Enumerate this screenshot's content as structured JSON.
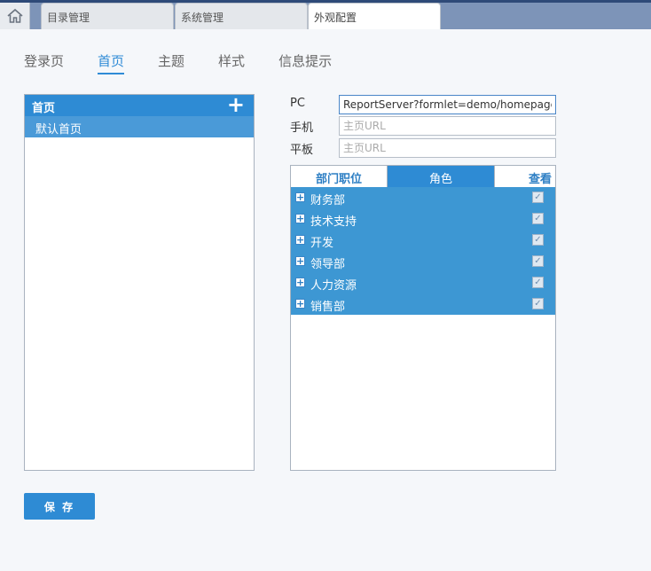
{
  "tabs": {
    "home_icon": "home-icon",
    "items": [
      {
        "label": "目录管理"
      },
      {
        "label": "系统管理"
      },
      {
        "label": "外观配置"
      }
    ]
  },
  "subnav": {
    "items": [
      {
        "label": "登录页"
      },
      {
        "label": "首页",
        "active": true
      },
      {
        "label": "主题"
      },
      {
        "label": "样式"
      },
      {
        "label": "信息提示"
      }
    ]
  },
  "homepage_list": {
    "header": "首页",
    "add_icon": "plus-icon",
    "items": [
      {
        "label": "默认首页"
      }
    ]
  },
  "form": {
    "pc": {
      "label": "PC",
      "value": "ReportServer?formlet=demo/homepage/finereport_homepage.frm"
    },
    "phone": {
      "label": "手机",
      "placeholder": "主页URL"
    },
    "tablet": {
      "label": "平板",
      "placeholder": "主页URL"
    }
  },
  "permissions": {
    "tabs": {
      "dept": "部门职位",
      "role": "角色",
      "view": "查看"
    },
    "rows": [
      {
        "name": "财务部",
        "checked": true
      },
      {
        "name": "技术支持",
        "checked": true
      },
      {
        "name": "开发",
        "checked": true
      },
      {
        "name": "领导部",
        "checked": true
      },
      {
        "name": "人力资源",
        "checked": true
      },
      {
        "name": "销售部",
        "checked": true
      }
    ]
  },
  "save_label": "保 存",
  "colors": {
    "accent": "#2e8bd4",
    "topbar": "#7d94b8"
  }
}
